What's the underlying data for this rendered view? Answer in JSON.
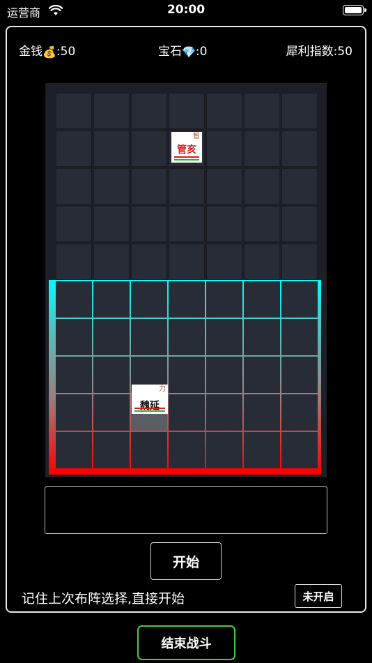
{
  "status_bar": {
    "carrier": "运营商",
    "time": "20:00"
  },
  "stats": {
    "money_label": "金钱",
    "money_icon": "money-bag-icon",
    "money_value": ":50",
    "gem_label": "宝石",
    "gem_icon": "gem-icon",
    "gem_value": ":0",
    "ratio_label": "犀利指数:50"
  },
  "board": {
    "columns": 7,
    "enemy_rows": 5,
    "player_rows": 5,
    "units": [
      {
        "side": "enemy",
        "row": 2,
        "col": 4,
        "name": "管亥",
        "attr": "智",
        "name_color": "#d21e1e",
        "attr_color": "#a05a2c"
      },
      {
        "side": "player",
        "row": 4,
        "col": 3,
        "name": "魏延",
        "attr": "力",
        "name_color": "#111111",
        "attr_color": "#a05a2c"
      }
    ],
    "colors": {
      "zone_top": "#00ffff",
      "zone_bottom": "#ff0000",
      "hp_bar": "#d21e1e",
      "power_bar": "#2bb52b"
    }
  },
  "controls": {
    "start_label": "开始",
    "remember_label": "记住上次布阵选择,直接开始",
    "toggle_label": "未开启",
    "end_battle_label": "结束战斗"
  }
}
